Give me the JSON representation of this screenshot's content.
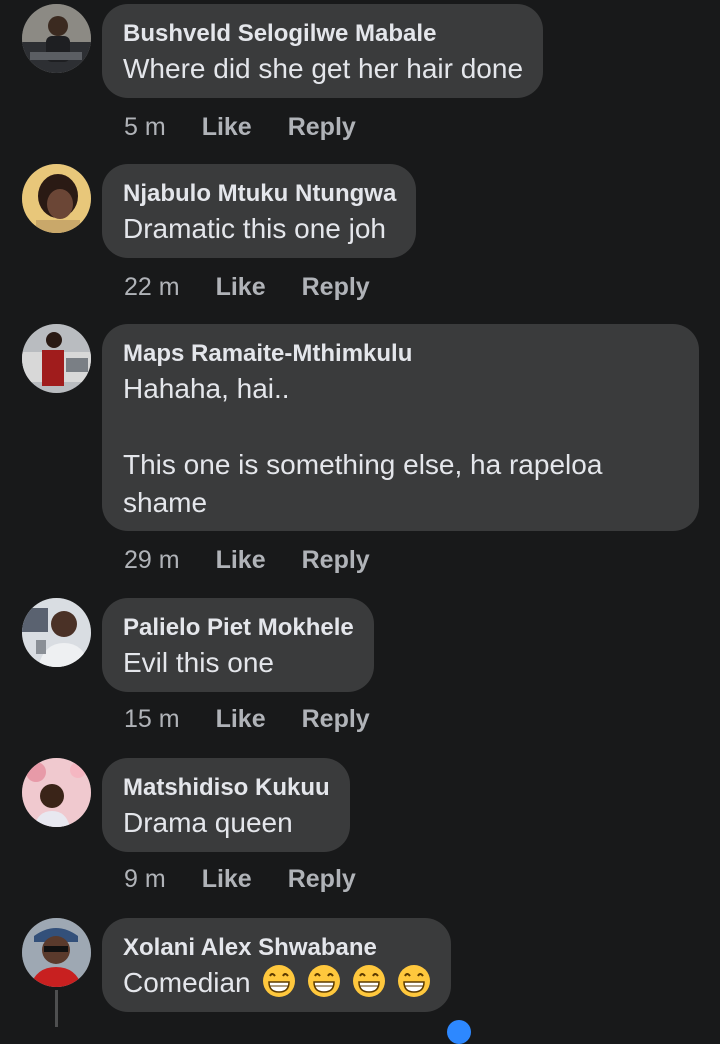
{
  "comments": [
    {
      "author": "Bushveld Selogilwe Mabale",
      "text": "Where did she get her hair done",
      "time": "5 m",
      "like": "Like",
      "reply": "Reply"
    },
    {
      "author": "Njabulo Mtuku Ntungwa",
      "text": "Dramatic this one joh",
      "time": "22 m",
      "like": "Like",
      "reply": "Reply"
    },
    {
      "author": "Maps Ramaite-Mthimkulu",
      "text": "Hahaha, hai..\n\nThis one is something else, ha rapeloa shame",
      "time": "29 m",
      "like": "Like",
      "reply": "Reply"
    },
    {
      "author": "Palielo Piet Mokhele",
      "text": "Evil this one",
      "time": "15 m",
      "like": "Like",
      "reply": "Reply"
    },
    {
      "author": "Matshidiso Kukuu",
      "text": "Drama queen",
      "time": "9 m",
      "like": "Like",
      "reply": "Reply"
    },
    {
      "author": "Xolani Alex Shwabane",
      "text": "Comedian",
      "emoji": [
        "grinning-face-with-smiling-eyes",
        "grinning-face-with-smiling-eyes",
        "grinning-face-with-smiling-eyes",
        "grinning-face-with-smiling-eyes"
      ]
    }
  ],
  "colors": {
    "background": "#18191a",
    "bubble": "#3a3b3c",
    "primary_text": "#e4e6eb",
    "secondary_text": "#b0b3b8"
  }
}
